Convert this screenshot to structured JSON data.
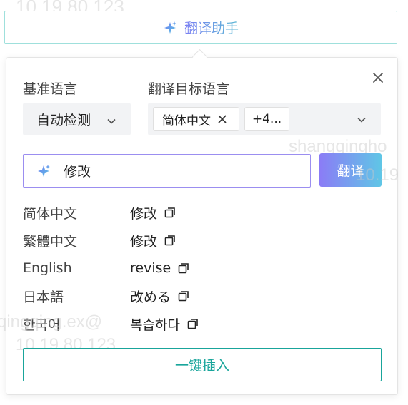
{
  "watermarks": [
    "10.19.80.123",
    "shangqingho",
    "10.19",
    "qingqing.ex@",
    "10.19.80.123"
  ],
  "assistant_button": {
    "label": "翻译助手",
    "icon": "sparkle-icon"
  },
  "panel": {
    "close_icon": "close-icon",
    "source_language": {
      "label": "基准语言",
      "value": "自动检测"
    },
    "target_languages": {
      "label": "翻译目标语言",
      "tag": "简体中文",
      "more": "+4..."
    },
    "input": {
      "value": "修改",
      "icon": "sparkle-icon"
    },
    "translate_button": "翻译",
    "results": [
      {
        "lang": "简体中文",
        "text": "修改"
      },
      {
        "lang": "繁體中文",
        "text": "修改"
      },
      {
        "lang": "English",
        "text": "revise"
      },
      {
        "lang": "日本語",
        "text": "改める"
      },
      {
        "lang": "한국어",
        "text": "복습하다"
      }
    ],
    "insert_button": "一键插入"
  },
  "colors": {
    "accent_teal": "#19a59b",
    "gradient_start": "#8b7cf6",
    "gradient_end": "#5fc6e6"
  }
}
